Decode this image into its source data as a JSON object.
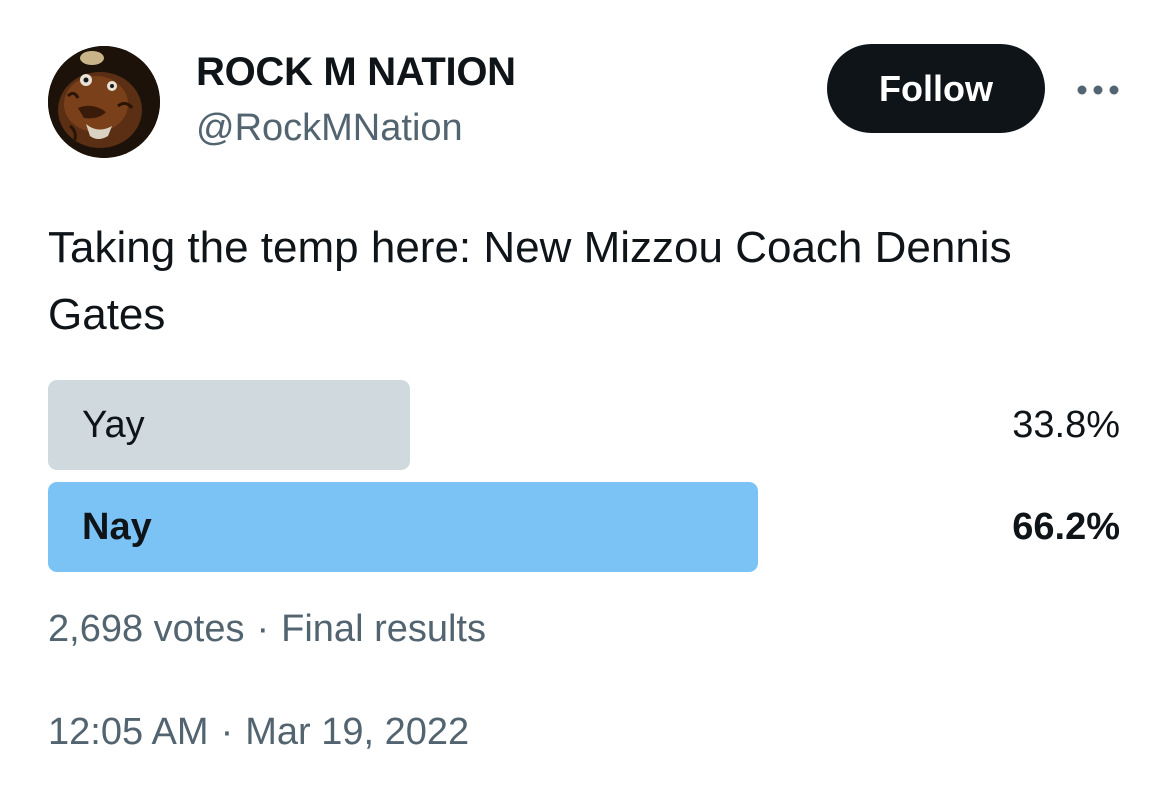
{
  "author": {
    "display_name": "ROCK M NATION",
    "handle": "@RockMNation",
    "avatar_icon": "tiger-mascot-avatar"
  },
  "actions": {
    "follow_label": "Follow",
    "more_icon": "more-horizontal-icon"
  },
  "tweet": {
    "text": "Taking the temp here: New Mizzou Coach Dennis Gates"
  },
  "poll": {
    "options": [
      {
        "label": "Yay",
        "percent_text": "33.8%",
        "percent": 33.8,
        "winner": false,
        "bar_color": "#cfd9de"
      },
      {
        "label": "Nay",
        "percent_text": "66.2%",
        "percent": 66.2,
        "winner": true,
        "bar_color": "#7cc3f5"
      }
    ],
    "votes": "2,698 votes",
    "status": "Final results",
    "separator": "·"
  },
  "meta": {
    "time": "12:05 AM",
    "date": "Mar 19, 2022",
    "separator": "·"
  }
}
